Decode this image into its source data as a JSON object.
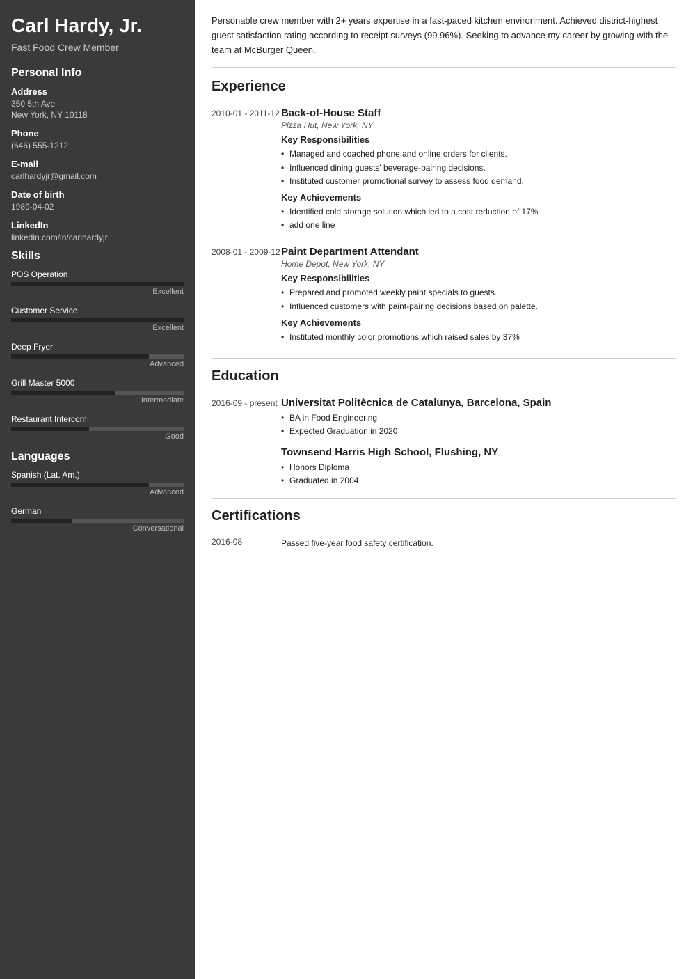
{
  "sidebar": {
    "name": "Carl Hardy, Jr.",
    "job_title": "Fast Food Crew Member",
    "personal_info_label": "Personal Info",
    "address_label": "Address",
    "address_line1": "350 5th Ave",
    "address_line2": "New York, NY 10118",
    "phone_label": "Phone",
    "phone": "(646) 555-1212",
    "email_label": "E-mail",
    "email": "carlhardyjr@gmail.com",
    "dob_label": "Date of birth",
    "dob": "1989-04-02",
    "linkedin_label": "LinkedIn",
    "linkedin": "linkedin.com/in/carlhardyjr",
    "skills_label": "Skills",
    "skills": [
      {
        "name": "POS Operation",
        "level": "Excellent",
        "percent": 100
      },
      {
        "name": "Customer Service",
        "level": "Excellent",
        "percent": 100
      },
      {
        "name": "Deep Fryer",
        "level": "Advanced",
        "percent": 80
      },
      {
        "name": "Grill Master 5000",
        "level": "Intermediate",
        "percent": 60
      },
      {
        "name": "Restaurant Intercom",
        "level": "Good",
        "percent": 45
      }
    ],
    "languages_label": "Languages",
    "languages": [
      {
        "name": "Spanish (Lat. Am.)",
        "level": "Advanced",
        "percent": 80
      },
      {
        "name": "German",
        "level": "Conversational",
        "percent": 35
      }
    ]
  },
  "main": {
    "summary": "Personable crew member with 2+ years expertise in a fast-paced kitchen environment. Achieved district-highest guest satisfaction rating according to receipt surveys (99.96%). Seeking to advance my career by growing with the team at McBurger Queen.",
    "experience_label": "Experience",
    "experiences": [
      {
        "date": "2010-01 - 2011-12",
        "title": "Back-of-House Staff",
        "company": "Pizza Hut, New York, NY",
        "responsibilities_label": "Key Responsibilities",
        "responsibilities": [
          "Managed and coached phone and online orders for clients.",
          "Influenced dining guests' beverage-pairing decisions.",
          "Instituted customer promotional survey to assess food demand."
        ],
        "achievements_label": "Key Achievements",
        "achievements": [
          "Identified cold storage solution which led to a cost reduction of 17%",
          "add one line"
        ]
      },
      {
        "date": "2008-01 - 2009-12",
        "title": "Paint Department Attendant",
        "company": "Home Depot, New York, NY",
        "responsibilities_label": "Key Responsibilities",
        "responsibilities": [
          "Prepared and promoted weekly paint specials to guests.",
          "Influenced customers with paint-pairing decisions based on palette."
        ],
        "achievements_label": "Key Achievements",
        "achievements": [
          "Instituted monthly color promotions which raised sales by 37%"
        ]
      }
    ],
    "education_label": "Education",
    "education": [
      {
        "date": "2016-09 - present",
        "school": "Universitat Politècnica de Catalunya, Barcelona, Spain",
        "items": [
          "BA in Food Engineering",
          "Expected Graduation in 2020"
        ]
      }
    ],
    "education2_school": "Townsend Harris High School, Flushing, NY",
    "education2_items": [
      "Honors Diploma",
      "Graduated in 2004"
    ],
    "certifications_label": "Certifications",
    "certifications": [
      {
        "date": "2016-08",
        "text": "Passed five-year food safety certification."
      }
    ]
  }
}
